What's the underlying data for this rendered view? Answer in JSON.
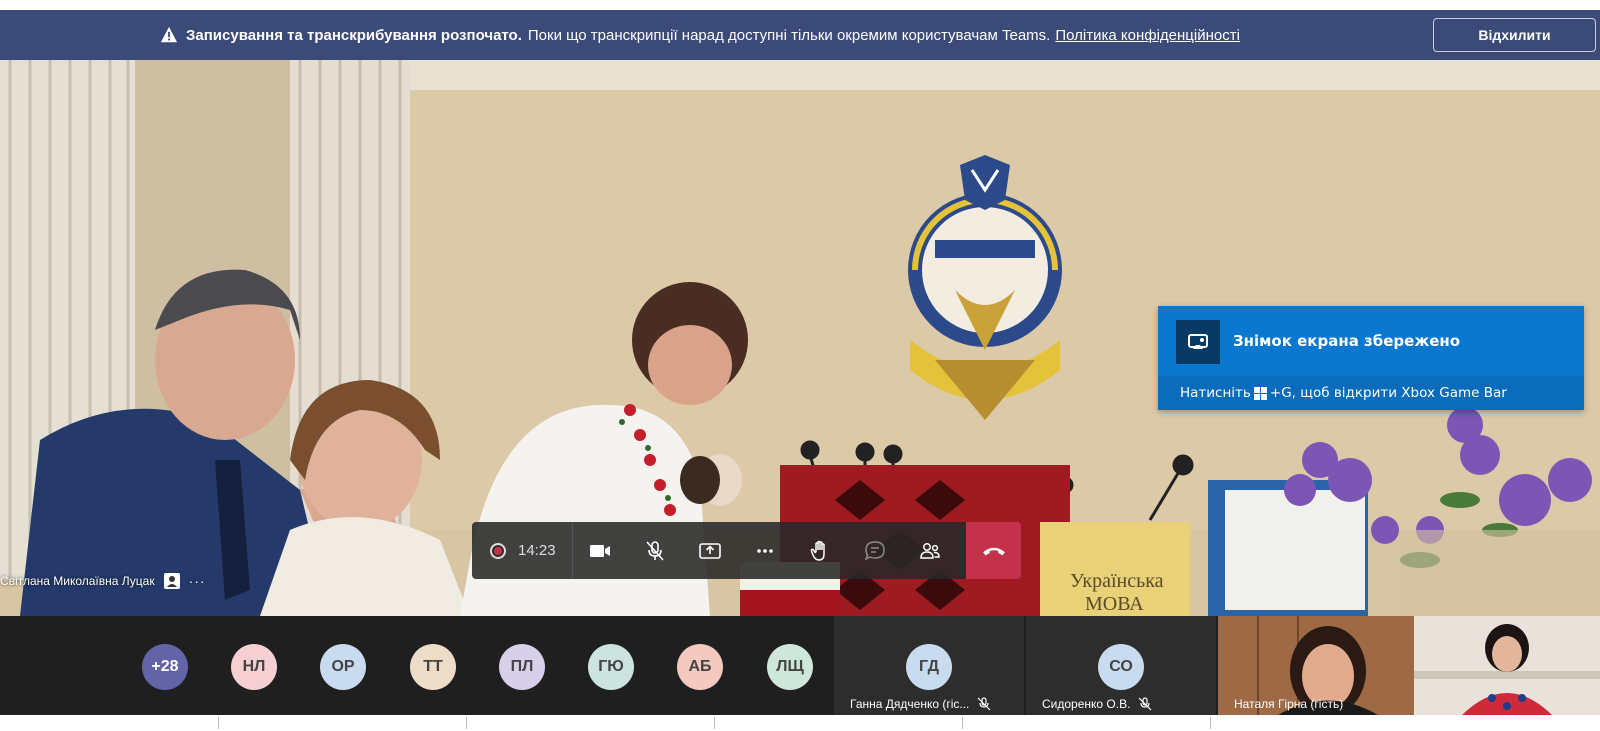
{
  "banner": {
    "bold_text": "Записування та транскрибування розпочато.",
    "text": "Поки що транскрипції нарад доступні тільки окремим користувачам Teams.",
    "link": "Політика конфіденційності",
    "dismiss_label": "Відхилити"
  },
  "main_speaker": {
    "name": "Світлана Миколаївна Луцак",
    "more": "···"
  },
  "toast": {
    "title": "Знімок екрана збережено",
    "sub_before": "Натисніть",
    "sub_after": "+G, щоб відкрити Xbox Game Bar"
  },
  "controls": {
    "timer": "14:23",
    "icons": [
      "camera-icon",
      "mic-off-icon",
      "share-icon",
      "more-icon",
      "raise-hand-icon",
      "chat-icon",
      "people-icon",
      "hang-up-icon"
    ]
  },
  "participants": {
    "overflow": "+28",
    "avatars": [
      {
        "initials": "НЛ",
        "color": "#f6cfd3"
      },
      {
        "initials": "ОР",
        "color": "#c9dbee"
      },
      {
        "initials": "ТТ",
        "color": "#eddcc7"
      },
      {
        "initials": "ПЛ",
        "color": "#d8cfe9"
      },
      {
        "initials": "ГЮ",
        "color": "#cde3df"
      },
      {
        "initials": "АБ",
        "color": "#f4c9c0"
      },
      {
        "initials": "ЛЩ",
        "color": "#cfe6da"
      }
    ],
    "tiles": [
      {
        "initials": "ГД",
        "name": "Ганна Дядченко (гіс...",
        "color": "#c9dbee"
      },
      {
        "initials": "СО",
        "name": "Сидоренко О.В.",
        "color": "#c9dbee"
      }
    ],
    "video_tiles": [
      {
        "name": "Наталя Гірна (гість)"
      }
    ]
  },
  "colors": {
    "banner_bg": "#3b4a78",
    "toast_bg": "#0b78d0",
    "hangup": "#c4314b",
    "overflow_avatar": "#6264a7"
  }
}
